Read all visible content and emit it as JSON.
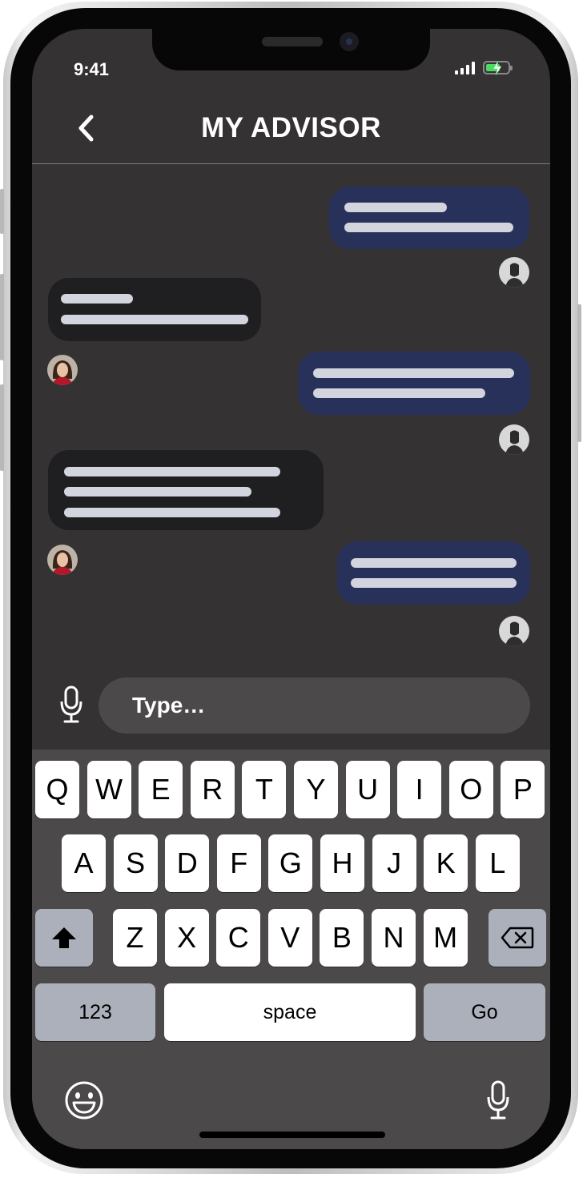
{
  "status_bar": {
    "time": "9:41"
  },
  "header": {
    "title": "MY ADVISOR"
  },
  "composer": {
    "placeholder": "Type…"
  },
  "keyboard": {
    "row1": [
      "Q",
      "W",
      "E",
      "R",
      "T",
      "Y",
      "U",
      "I",
      "O",
      "P"
    ],
    "row2": [
      "A",
      "S",
      "D",
      "F",
      "G",
      "H",
      "J",
      "K",
      "L"
    ],
    "row3": [
      "Z",
      "X",
      "C",
      "V",
      "B",
      "N",
      "M"
    ],
    "numbers_label": "123",
    "space_label": "space",
    "go_label": "Go"
  },
  "icons": {
    "back": "chevron-left-icon",
    "mic": "microphone-icon",
    "shift": "shift-arrow-icon",
    "delete": "backspace-icon",
    "emoji": "smiley-face-icon",
    "dictation": "microphone-icon"
  },
  "colors": {
    "screen_bg": "#343233",
    "outgoing_bubble": "#27315a",
    "incoming_bubble": "#1f1e20",
    "keyboard_bg": "#4b494a",
    "key_special": "#abb0bb"
  }
}
